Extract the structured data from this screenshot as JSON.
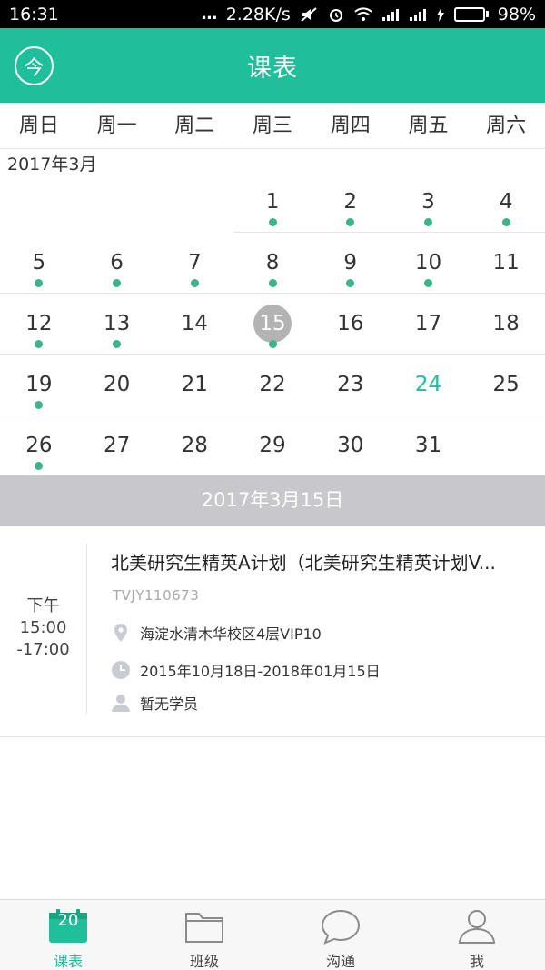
{
  "status_bar": {
    "time": "16:31",
    "dots": "...",
    "speed": "2.28K/s",
    "battery_percent": "98%",
    "battery_level": 0.98
  },
  "header": {
    "today_button": "今",
    "title": "课表"
  },
  "weekdays": [
    "周日",
    "周一",
    "周二",
    "周三",
    "周四",
    "周五",
    "周六"
  ],
  "calendar": {
    "month_label": "2017年3月",
    "rows": [
      [
        {
          "day": ""
        },
        {
          "day": ""
        },
        {
          "day": ""
        },
        {
          "day": "1",
          "has_class": true
        },
        {
          "day": "2",
          "has_class": true
        },
        {
          "day": "3",
          "has_class": true
        },
        {
          "day": "4",
          "has_class": true
        }
      ],
      [
        {
          "day": "5",
          "has_class": true
        },
        {
          "day": "6",
          "has_class": true
        },
        {
          "day": "7",
          "has_class": true
        },
        {
          "day": "8",
          "has_class": true
        },
        {
          "day": "9",
          "has_class": true
        },
        {
          "day": "10",
          "has_class": true
        },
        {
          "day": "11"
        }
      ],
      [
        {
          "day": "12",
          "has_class": true
        },
        {
          "day": "13",
          "has_class": true
        },
        {
          "day": "14"
        },
        {
          "day": "15",
          "has_class": true,
          "selected": true
        },
        {
          "day": "16"
        },
        {
          "day": "17"
        },
        {
          "day": "18"
        }
      ],
      [
        {
          "day": "19",
          "has_class": true
        },
        {
          "day": "20"
        },
        {
          "day": "21"
        },
        {
          "day": "22"
        },
        {
          "day": "23"
        },
        {
          "day": "24",
          "today": true
        },
        {
          "day": "25"
        }
      ],
      [
        {
          "day": "26",
          "has_class": true
        },
        {
          "day": "27"
        },
        {
          "day": "28"
        },
        {
          "day": "29"
        },
        {
          "day": "30"
        },
        {
          "day": "31"
        },
        {
          "day": ""
        }
      ]
    ]
  },
  "selected_date": "2017年3月15日",
  "class_item": {
    "period": "下午",
    "start_time": "15:00",
    "end_time": "-17:00",
    "title": "北美研究生精英A计划（北美研究生精英计划V...",
    "code": "TVJY110673",
    "location": "海淀水清木华校区4层VIP10",
    "date_range": "2015年10月18日-2018年01月15日",
    "students": "暂无学员"
  },
  "tabbar": {
    "tabs": [
      {
        "label": "课表",
        "icon": "calendar-icon",
        "badge": "20",
        "active": true
      },
      {
        "label": "班级",
        "icon": "folder-icon"
      },
      {
        "label": "沟通",
        "icon": "chat-bubble-icon"
      },
      {
        "label": "我",
        "icon": "person-icon"
      }
    ]
  },
  "colors": {
    "accent": "#1fbf9b",
    "dot": "#3db389",
    "selected_day": "#b3b3b3",
    "date_bar": "#c8c8cc"
  }
}
